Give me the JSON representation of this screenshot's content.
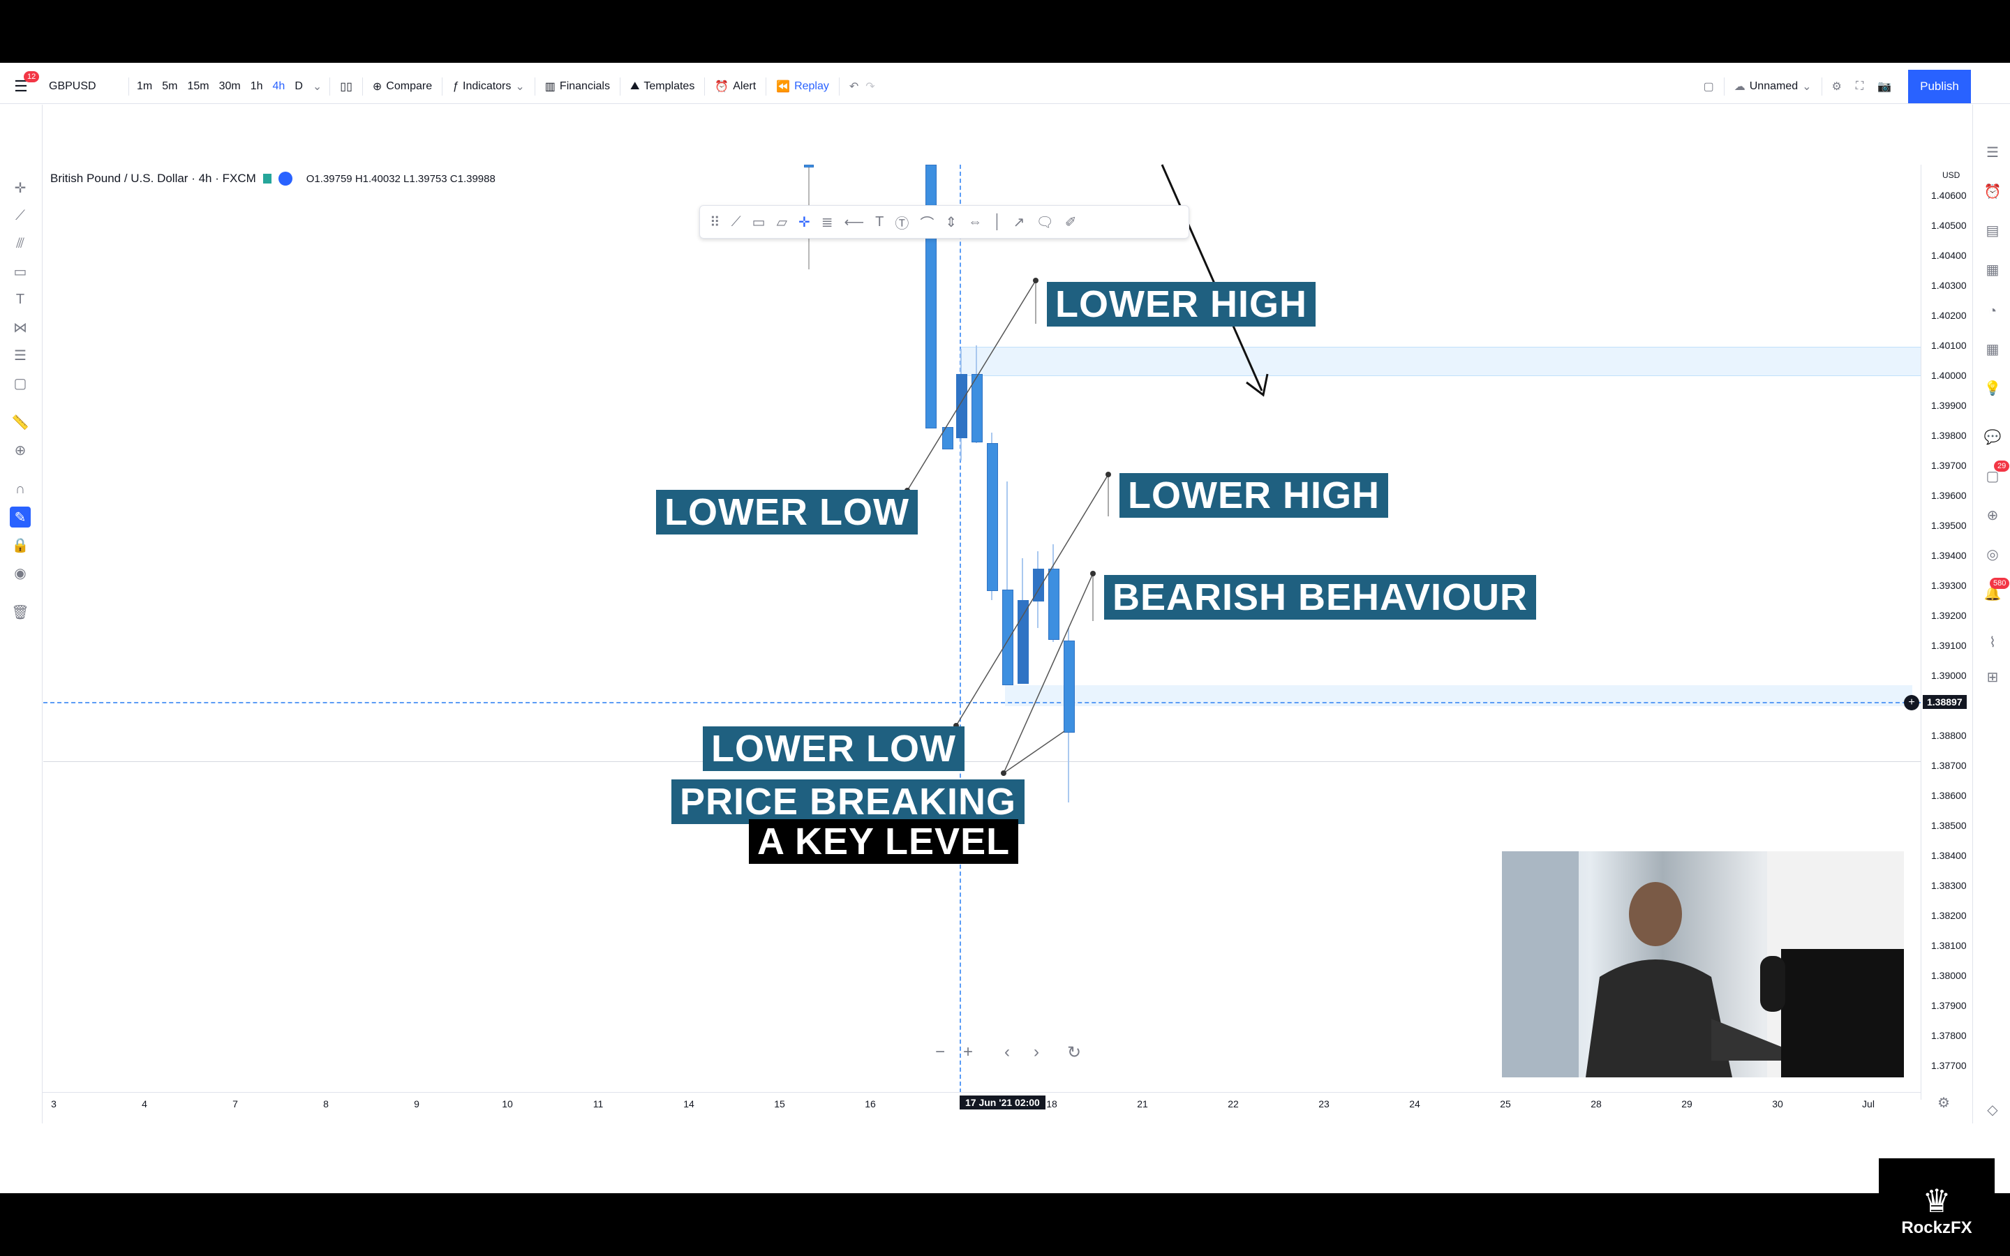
{
  "toolbar": {
    "menu_badge": "12",
    "symbol": "GBPUSD",
    "intervals": [
      "1m",
      "5m",
      "15m",
      "30m",
      "1h",
      "4h",
      "D"
    ],
    "active_interval": "4h",
    "compare": "Compare",
    "indicators": "Indicators",
    "financials": "Financials",
    "templates": "Templates",
    "alert": "Alert",
    "replay": "Replay",
    "layout_name": "Unnamed",
    "publish": "Publish"
  },
  "legend": {
    "title": "British Pound / U.S. Dollar · 4h · FXCM",
    "ohlc": "O1.39759  H1.40032  L1.39753  C1.39988"
  },
  "price_scale": {
    "currency": "USD",
    "ticks": [
      "1.40600",
      "1.40500",
      "1.40400",
      "1.40300",
      "1.40200",
      "1.40100",
      "1.40000",
      "1.39900",
      "1.39800",
      "1.39700",
      "1.39600",
      "1.39500",
      "1.39400",
      "1.39300",
      "1.39200",
      "1.39100",
      "1.39000",
      "1.38800",
      "1.38700",
      "1.38600",
      "1.38500",
      "1.38400",
      "1.38300",
      "1.38200",
      "1.38100",
      "1.38000",
      "1.37900",
      "1.37800",
      "1.37700"
    ],
    "current_price": "1.38897"
  },
  "time_axis": {
    "ticks": [
      "3",
      "4",
      "7",
      "8",
      "9",
      "10",
      "11",
      "14",
      "15",
      "16",
      "18",
      "21",
      "22",
      "23",
      "24",
      "25",
      "28",
      "29",
      "30",
      "Jul"
    ],
    "selected": "17 Jun '21   02:00"
  },
  "annotations": {
    "lower_high_1": "LOWER HIGH",
    "lower_low_1": "LOWER LOW",
    "lower_high_2": "LOWER HIGH",
    "bearish": "BEARISH BEHAVIOUR",
    "lower_low_2": "LOWER LOW",
    "price_breaking": "PRICE BREAKING",
    "key_level": "A KEY LEVEL"
  },
  "right_rail": {
    "badge_ideas": "29",
    "badge_notifications": "580"
  },
  "watermark": {
    "brand": "RockzFX"
  },
  "colors": {
    "accent": "#2962ff",
    "candle": "#3d8fe0",
    "label_bg": "#1f6080",
    "zone": "#64b4f6"
  }
}
